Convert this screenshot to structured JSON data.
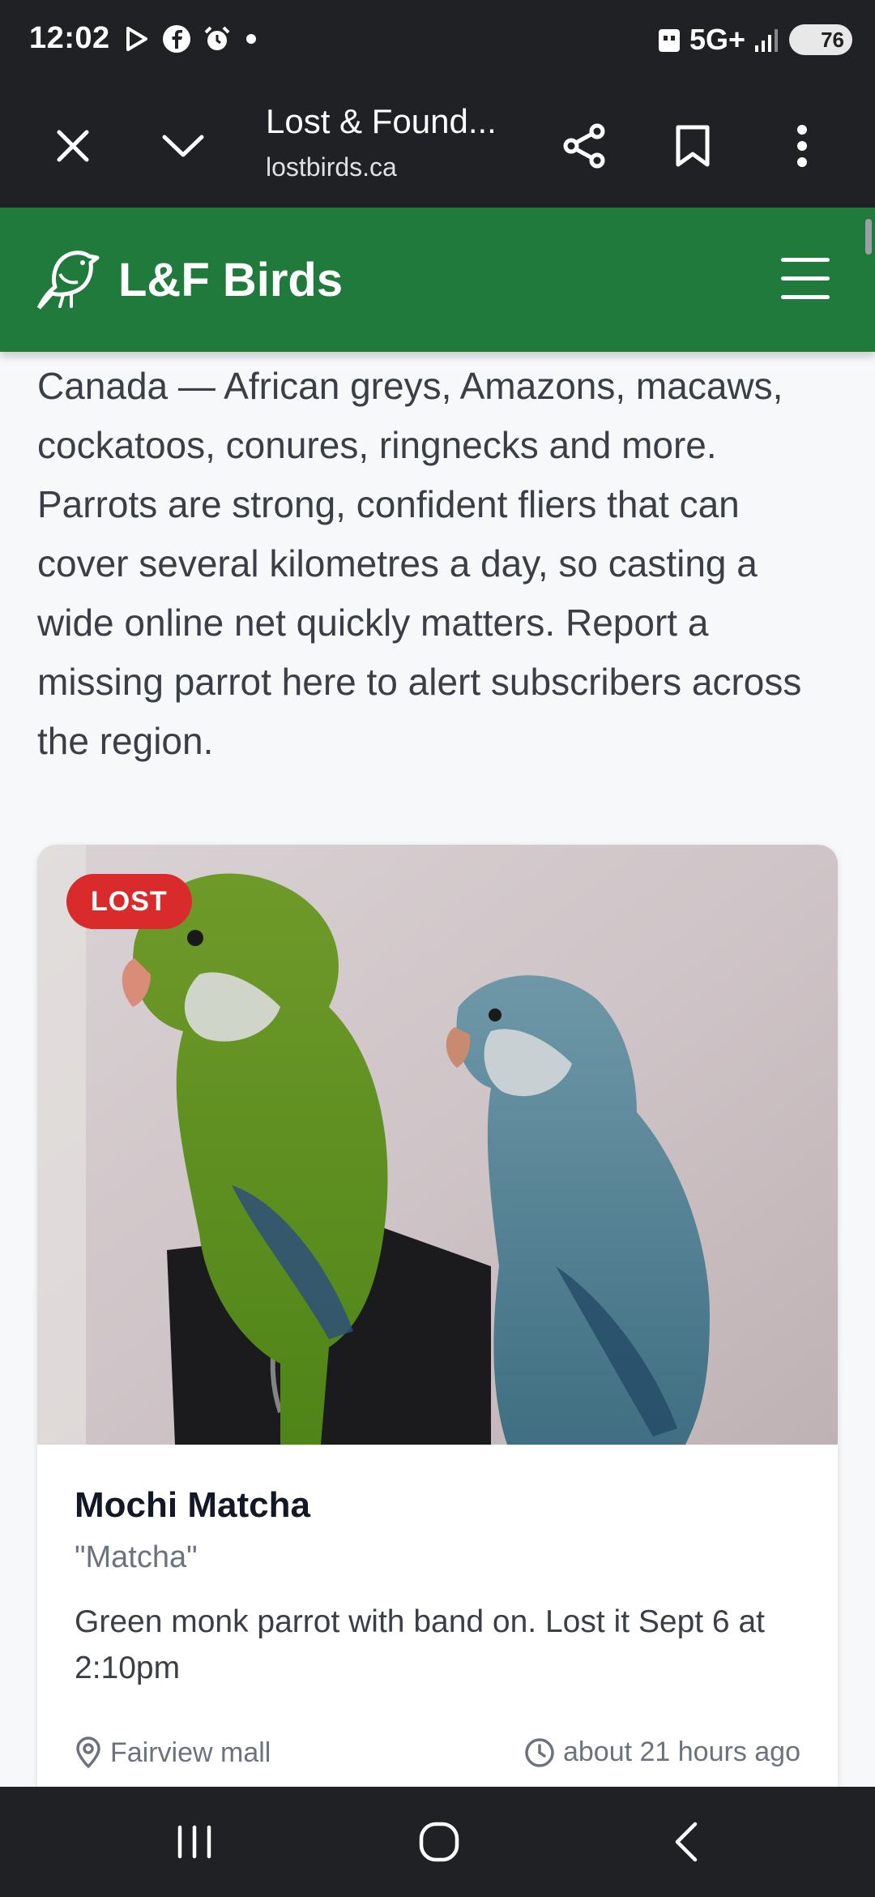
{
  "status_bar": {
    "time": "12:02",
    "network": "5G+",
    "battery": "76"
  },
  "browser": {
    "title": "Lost & Found...",
    "url": "lostbirds.ca"
  },
  "site": {
    "brand": "L&F Birds"
  },
  "intro": {
    "text": "Canada — African greys, Amazons, macaws, cockatoos, conures, ringnecks and more. Parrots are strong, confident fliers that can cover several kilometres a day, so casting a wide online net quickly matters. Report a missing parrot here to alert subscribers across the region."
  },
  "listing": {
    "status": "LOST",
    "name": "Mochi Matcha",
    "nickname": "\"Matcha\"",
    "description": "Green monk parrot with band on. Lost it Sept 6 at 2:10pm",
    "location": "Fairview mall",
    "posted": "about 21 hours ago"
  },
  "colors": {
    "header_green": "#1f7a3b",
    "lost_red": "#d92b2b",
    "system_bar": "#202124"
  },
  "icons": [
    "play-icon",
    "facebook-icon",
    "alarm-icon",
    "close-icon",
    "chevron-down-icon",
    "share-icon",
    "bookmark-icon",
    "more-vert-icon",
    "bird-logo-icon",
    "menu-icon",
    "location-pin-icon",
    "clock-icon",
    "recents-icon",
    "home-icon",
    "back-icon"
  ]
}
